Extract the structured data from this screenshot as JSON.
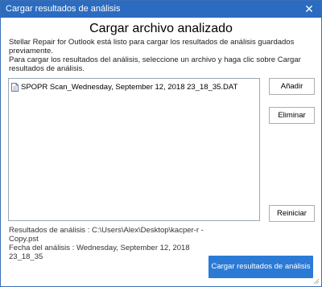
{
  "window": {
    "title": "Cargar resultados de análisis",
    "close_glyph": "✕"
  },
  "dialog": {
    "heading": "Cargar archivo analizado",
    "description_line1": "Stellar Repair for Outlook está listo para cargar los resultados de análisis guardados",
    "description_line2": "previamente.",
    "description_line3": "Para cargar los resultados del análisis, seleccione un archivo y haga clic sobre Cargar",
    "description_line4": "resultados de análisis."
  },
  "file_list": {
    "items": [
      {
        "name": "SPOPR Scan_Wednesday, September 12, 2018 23_18_35.DAT",
        "icon": "document-icon"
      }
    ]
  },
  "buttons": {
    "add": "Añadir",
    "remove": "Eliminar",
    "reset": "Reiniciar",
    "load": "Cargar resultados de análisis"
  },
  "results": {
    "path_line1": "Resultados de análisis : C:\\Users\\Alex\\Desktop\\kacper-r -",
    "path_line2": "Copy.pst",
    "date_line": "Fecha del análisis : Wednesday, September 12, 2018 23_18_35"
  },
  "colors": {
    "titlebar": "#2b6cc0",
    "primary_button": "#2b7ad6"
  }
}
